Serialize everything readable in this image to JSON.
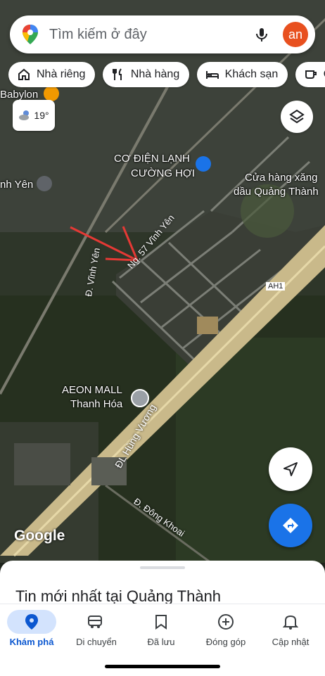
{
  "search": {
    "placeholder": "Tìm kiếm ở đây",
    "avatar_text": "an"
  },
  "chips": [
    {
      "label": "Nhà riêng",
      "icon": "home-icon"
    },
    {
      "label": "Nhà hàng",
      "icon": "restaurant-icon"
    },
    {
      "label": "Khách sạn",
      "icon": "hotel-icon"
    },
    {
      "label": "Q",
      "icon": "coffee-icon"
    }
  ],
  "weather": {
    "temp": "19°"
  },
  "map_labels": {
    "babylon": "Babylon",
    "co_dien_1": "CƠ ĐIỆN LẠNH",
    "co_dien_2": "CƯỜNG HỢI",
    "xang_1": "Cửa hàng xăng",
    "xang_2": "dầu Quảng Thành",
    "vinh_yen_left": "nh Yên",
    "aeon_1": "AEON MALL",
    "aeon_2": "Thanh Hóa",
    "ngo_vinh_yen": "Ng. 57 Vĩnh Yên",
    "d_vinh_yen": "Đ. Vĩnh Yên",
    "hung_vuong": "ĐL Hùng Vương",
    "dong_khoai": "Đ. Đông Khoai",
    "ah1": "AH1",
    "google": "Google"
  },
  "sheet": {
    "title": "Tin mới nhất tại Quảng Thành"
  },
  "nav": [
    {
      "label": "Khám phá",
      "icon": "explore-pin-icon",
      "active": true
    },
    {
      "label": "Di chuyển",
      "icon": "car-icon",
      "active": false
    },
    {
      "label": "Đã lưu",
      "icon": "bookmark-icon",
      "active": false
    },
    {
      "label": "Đóng góp",
      "icon": "add-circle-icon",
      "active": false
    },
    {
      "label": "Cập nhật",
      "icon": "bell-icon",
      "active": false
    }
  ],
  "colors": {
    "accent": "#1a73e8",
    "avatar": "#e8501f",
    "poi_blue": "#1a73e8",
    "active_pill": "#d3e3fd",
    "arrow": "#e53935"
  }
}
